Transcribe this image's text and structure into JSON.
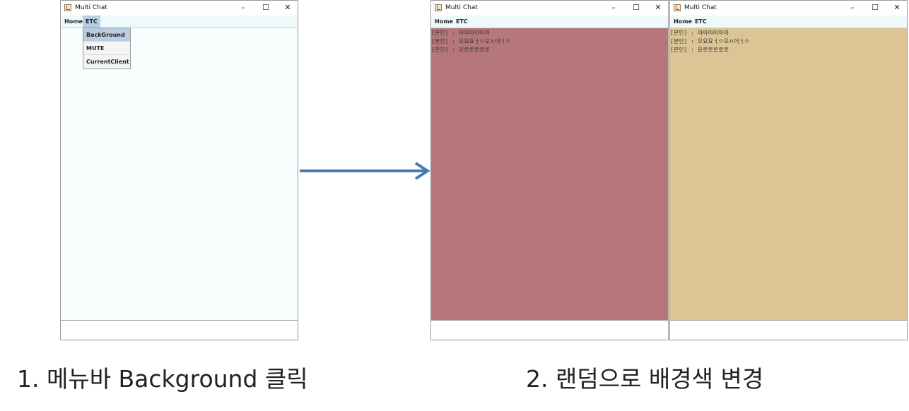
{
  "window_title": "Multi Chat",
  "controls": {
    "minimize": "–",
    "maximize": "☐",
    "close": "✕"
  },
  "menus": {
    "home": "Home",
    "etc": "ETC"
  },
  "dropdown": [
    "BackGround",
    "MUTE",
    "CurrentClient"
  ],
  "messages": [
    "[본인] : 아아아아아아",
    "[본인] : 오요요ㅓㅇ오ㅛ어ㅓㅇ",
    "[본인] : 요로로로로로"
  ],
  "windows": [
    {
      "chat_bg": "#f8fefe",
      "menu_bg": "#eefafa",
      "show_messages": false,
      "etc_active": true
    },
    {
      "chat_bg": "#b6777c",
      "menu_bg": "#eefafa",
      "show_messages": true,
      "etc_active": false
    },
    {
      "chat_bg": "#dcc494",
      "menu_bg": "#eefafa",
      "show_messages": true,
      "etc_active": false
    }
  ],
  "arrow_color": "#4a78b0",
  "captions": {
    "step1": "1. 메뉴바 Background 클릭",
    "step2": "2. 랜덤으로 배경색 변경"
  }
}
